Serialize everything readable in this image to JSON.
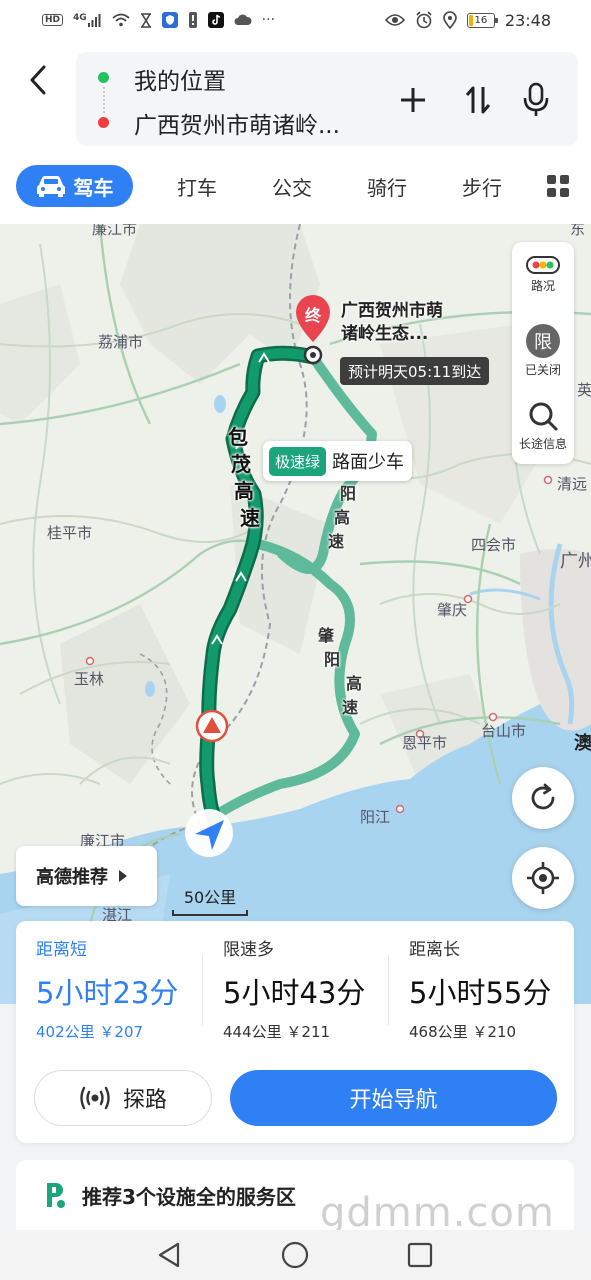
{
  "status_bar": {
    "left_icons": [
      "hd-badge",
      "4g-signal-icon",
      "wifi-icon",
      "hourglass-icon",
      "shield-app-icon",
      "alert-icon",
      "tiktok-icon",
      "cloud-icon"
    ],
    "hd": "HD",
    "signal": "4G",
    "more": "···",
    "battery_level": "16",
    "time": "23:48"
  },
  "header": {
    "origin": "我的位置",
    "destination": "广西贺州市萌诸岭...",
    "modes": [
      {
        "label": "驾车",
        "active": true
      },
      {
        "label": "打车",
        "active": false
      },
      {
        "label": "公交",
        "active": false
      },
      {
        "label": "骑行",
        "active": false
      },
      {
        "label": "步行",
        "active": false
      }
    ]
  },
  "map": {
    "places": {
      "lianjiang_top": "廉江市",
      "lipu": "荔浦市",
      "guiping": "桂平市",
      "yulin": "玉林",
      "lianjiang": "廉江市",
      "zhanjiang": "湛江",
      "sihui": "四会市",
      "guangzhou": "广州",
      "zhaoqing": "肇庆",
      "taishan": "台山市",
      "enping": "恩平市",
      "yangjiang": "阳江",
      "qingyuan": "清远",
      "ying": "英",
      "dong": "东",
      "ao": "澳"
    },
    "destination_marker": "终",
    "destination_label_line1": "广西贺州市萌",
    "destination_label_line2": "诸岭生态...",
    "eta": "预计明天05:11到达",
    "traffic_tag": "极速绿",
    "traffic_text": "路面少车",
    "highway_main": [
      "包",
      "茂",
      "高",
      "速"
    ],
    "highway_alt1": [
      "阳",
      "高",
      "速"
    ],
    "highway_alt2": [
      "肇",
      "阳",
      "高",
      "速"
    ],
    "side_panel": {
      "traffic": "路况",
      "restriction_icon": "限",
      "restriction": "已关闭",
      "long_info": "长途信息"
    },
    "recommend": "高德推荐",
    "scale": "50公里"
  },
  "routes": [
    {
      "tag": "距离短",
      "time": "5小时23分",
      "distance": "402公里",
      "cost": "￥207",
      "selected": true
    },
    {
      "tag": "限速多",
      "time": "5小时43分",
      "distance": "444公里",
      "cost": "￥211",
      "selected": false
    },
    {
      "tag": "距离长",
      "time": "5小时55分",
      "distance": "468公里",
      "cost": "￥210",
      "selected": false
    }
  ],
  "actions": {
    "explore": "探路",
    "start": "开始导航"
  },
  "service": {
    "text": "推荐3个设施全的服务区"
  },
  "watermark": "gdmm.com",
  "colors": {
    "accent": "#2f7ff5",
    "route_primary": "#0e8a62",
    "route_alt": "#5fb99b",
    "destination_red": "#e94450"
  }
}
